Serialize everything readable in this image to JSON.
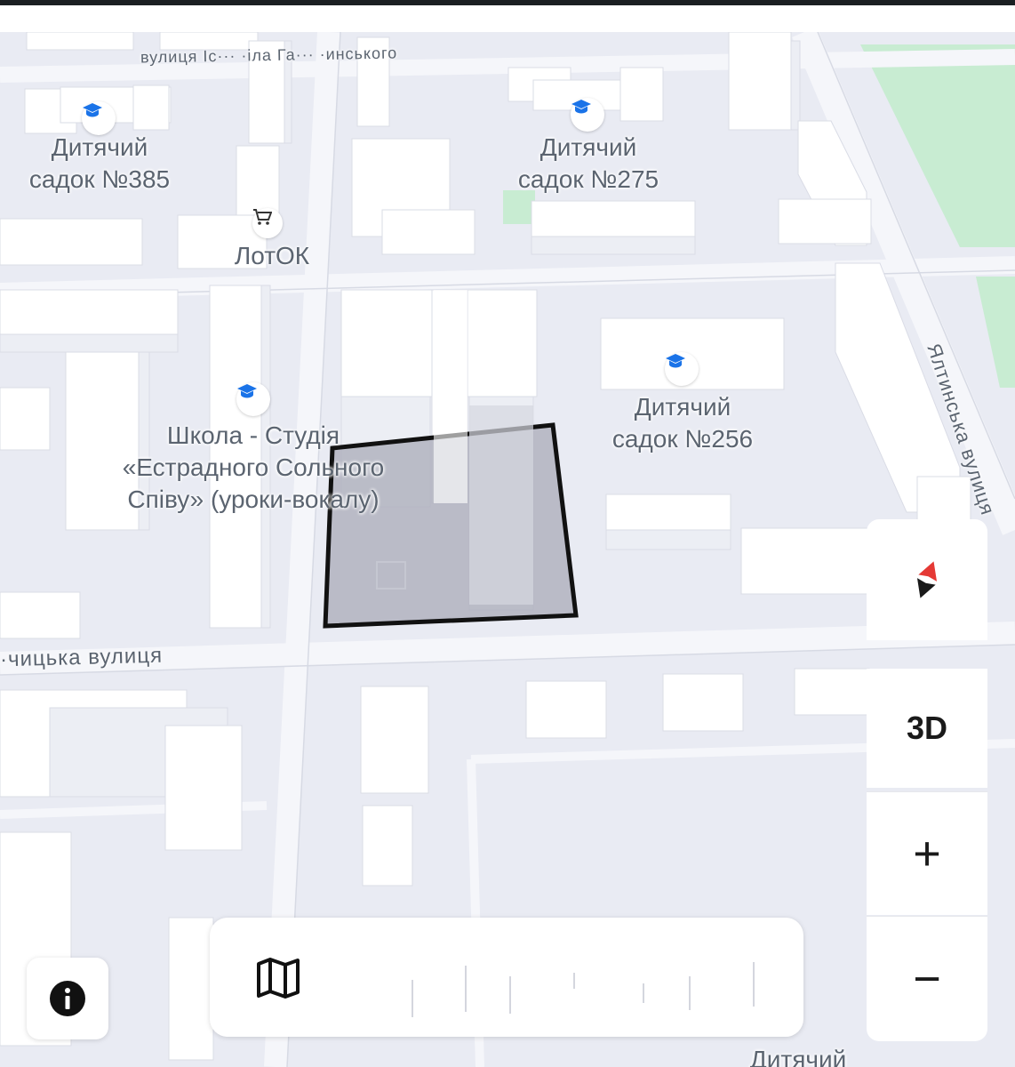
{
  "colors": {
    "top_bar": "#1b1f22",
    "map_background": "#e9ebf3",
    "road": "#f5f6fa",
    "building": "#ffffff",
    "park": "#c8ecd2",
    "selected_area": "#a9abb8",
    "selected_outline": "#111111",
    "poi_icon": "#1a73e8",
    "label_text": "#5b6470",
    "compass_north": "#e53935",
    "compass_south": "#1a1a1a"
  },
  "streets": {
    "top": "вулиця Іс··· ·іла Га··· ·инського",
    "yaltynska": "Ялтинська вулиця",
    "bottom": "·чицька вулиця"
  },
  "pois": [
    {
      "id": "kindergarten-385",
      "icon": "school-icon",
      "lines": [
        "Дитячий",
        "садок №385"
      ]
    },
    {
      "id": "kindergarten-275",
      "icon": "school-icon",
      "lines": [
        "Дитячий",
        "садок №275"
      ]
    },
    {
      "id": "lotok",
      "icon": "shopping-cart-icon",
      "lines": [
        "ЛотОК"
      ]
    },
    {
      "id": "vocal-school",
      "icon": "school-icon",
      "lines": [
        "Школа - Студія",
        "«Естрадного Сольного",
        "Співу» (уроки-вокалу)"
      ]
    },
    {
      "id": "kindergarten-256",
      "icon": "school-icon",
      "lines": [
        "Дитячий",
        "садок №256"
      ]
    },
    {
      "id": "kindergarten-partial",
      "icon": "school-icon",
      "lines": [
        "Дитячий"
      ]
    }
  ],
  "controls": {
    "compass": "compass-icon",
    "view_3d_label": "3D",
    "zoom_in_label": "+",
    "zoom_out_label": "−",
    "info": "info-icon",
    "map_layers": "map-icon"
  }
}
